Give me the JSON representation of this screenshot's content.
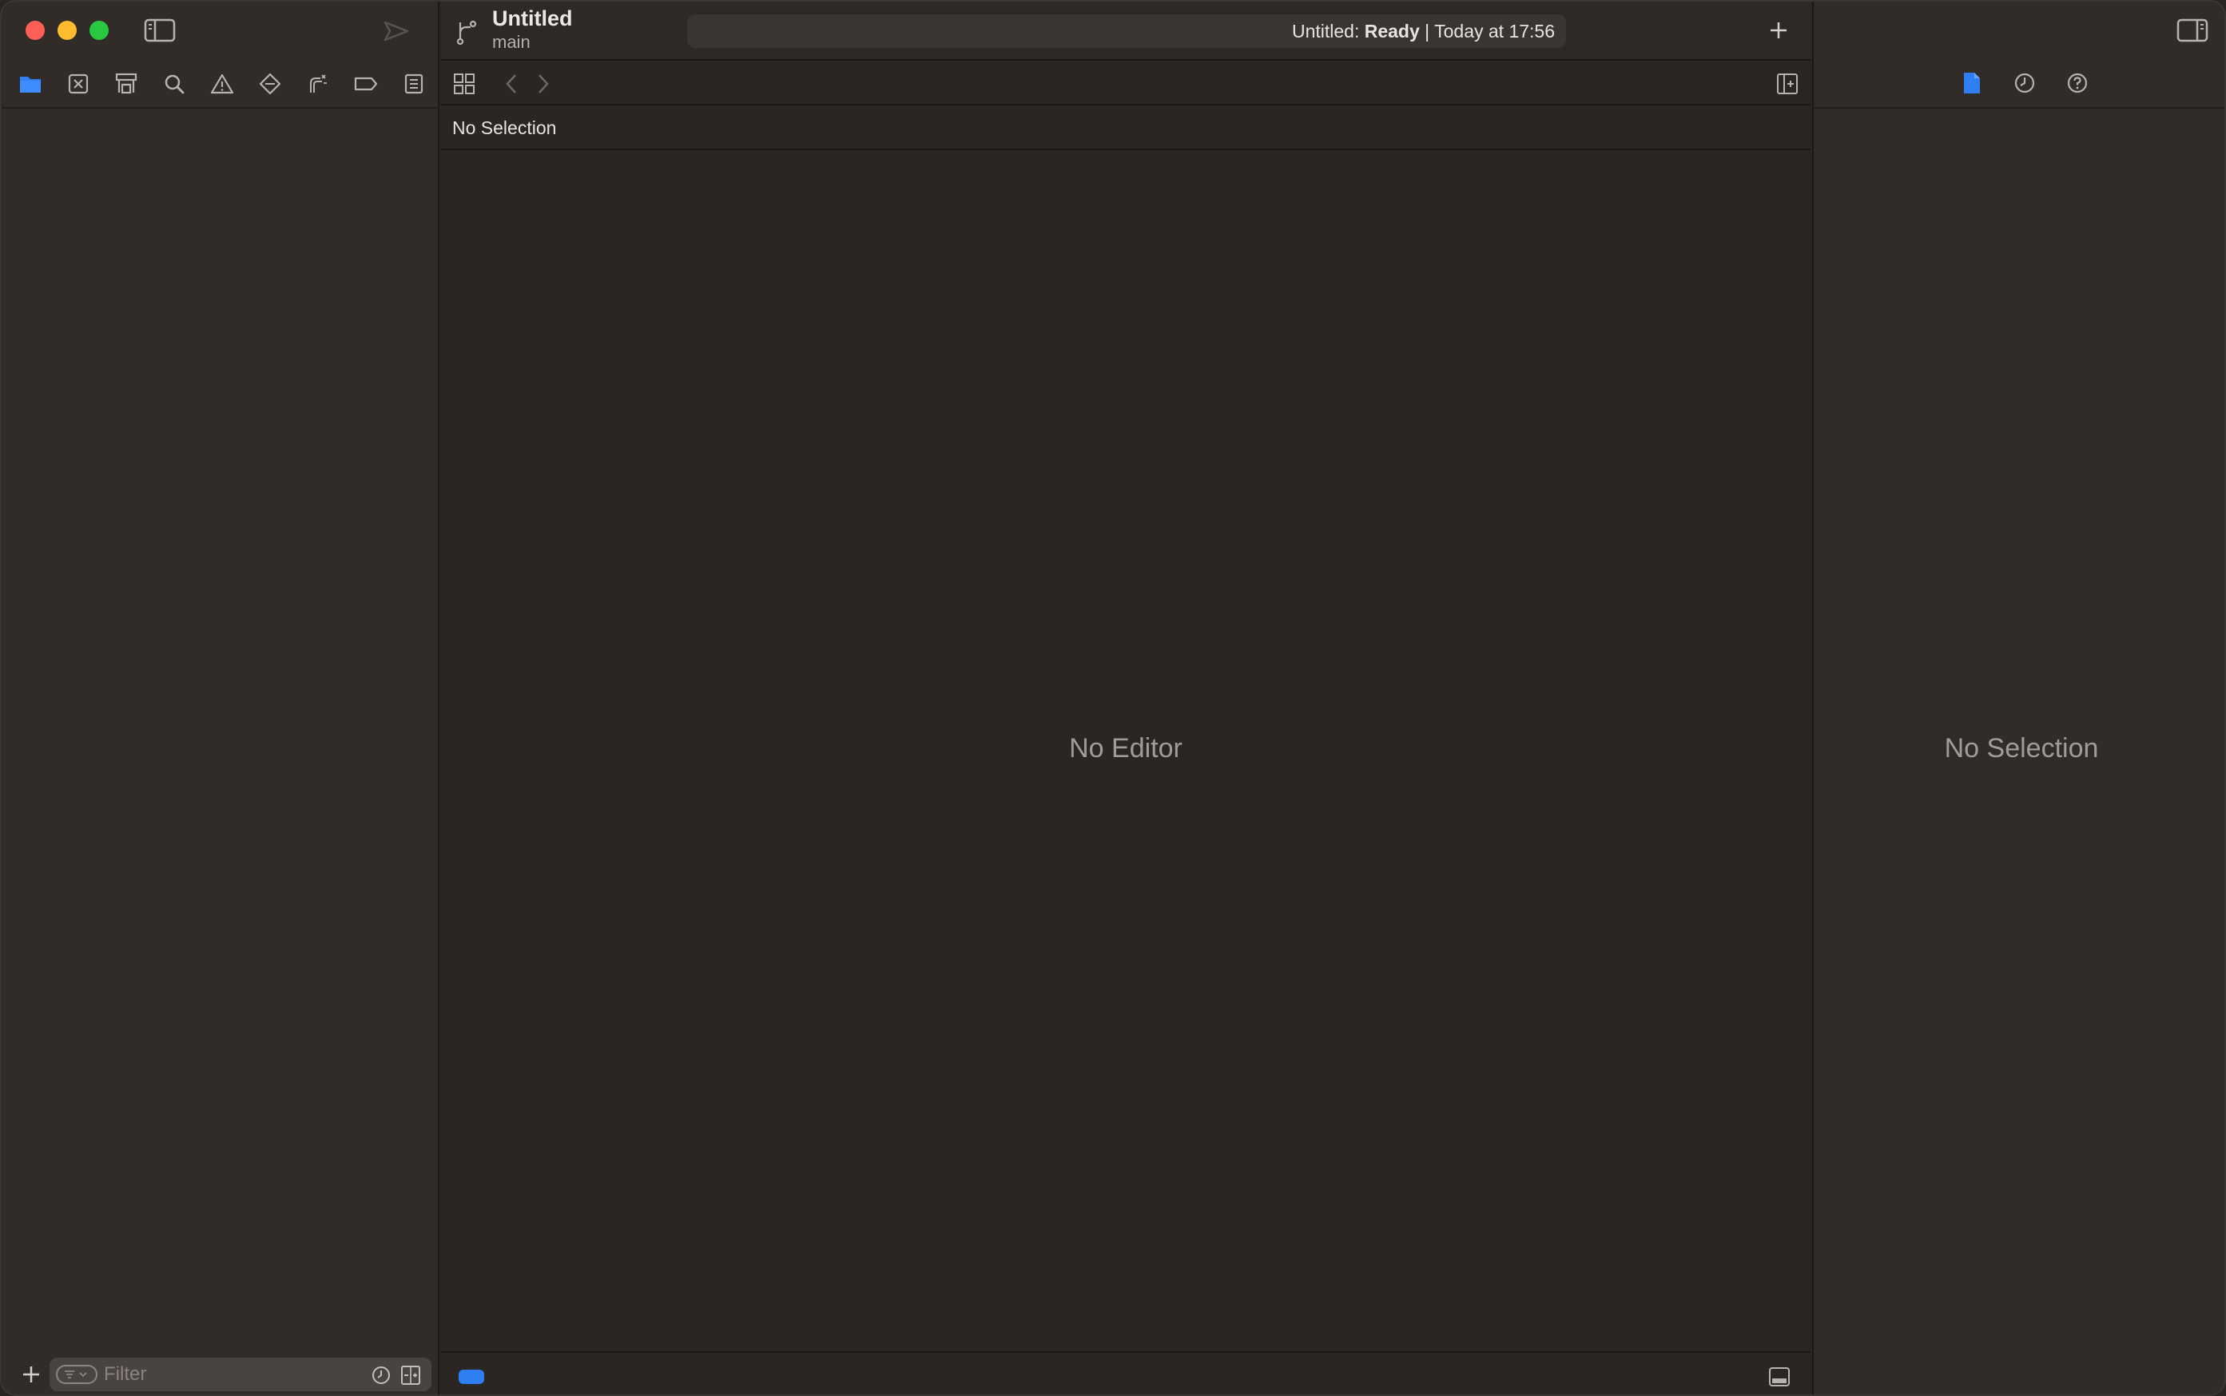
{
  "window": {
    "project_title": "Untitled",
    "branch": "main",
    "activity": {
      "prefix": "Untitled: ",
      "status": "Ready",
      "suffix": " | Today at 17:56"
    }
  },
  "navigator": {
    "tabs": [
      {
        "icon": "folder-icon",
        "selected": true
      },
      {
        "icon": "source-control-icon"
      },
      {
        "icon": "symbol-icon"
      },
      {
        "icon": "search-icon"
      },
      {
        "icon": "warning-icon"
      },
      {
        "icon": "test-icon"
      },
      {
        "icon": "debug-icon"
      },
      {
        "icon": "breakpoint-icon"
      },
      {
        "icon": "report-icon"
      }
    ],
    "filter_placeholder": "Filter"
  },
  "editor": {
    "jump_bar": "No Selection",
    "empty_message": "No Editor"
  },
  "inspector": {
    "empty_message": "No Selection"
  },
  "colors": {
    "accent": "#2f7ff2",
    "close": "#fe5f57",
    "minimize": "#febc2e",
    "zoom": "#28c840"
  }
}
